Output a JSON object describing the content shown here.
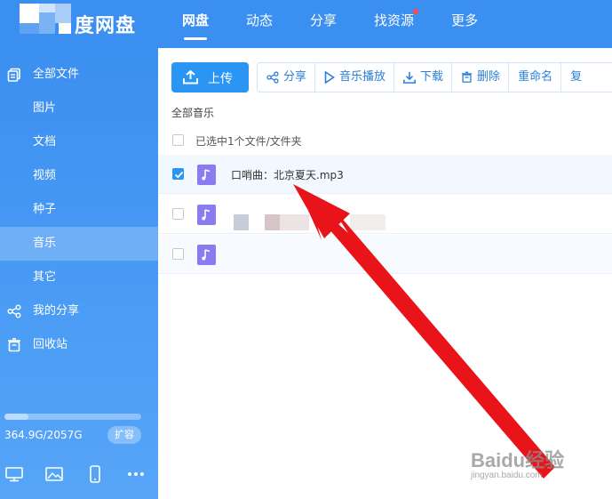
{
  "app": {
    "logo_text": "度网盘",
    "nav": [
      {
        "label": "网盘",
        "active": true
      },
      {
        "label": "动态",
        "active": false
      },
      {
        "label": "分享",
        "active": false
      },
      {
        "label": "找资源",
        "active": false,
        "badge": true
      },
      {
        "label": "更多",
        "active": false
      }
    ]
  },
  "sidebar": {
    "items": [
      {
        "label": "全部文件",
        "icon": "files-icon"
      },
      {
        "label": "图片"
      },
      {
        "label": "文档"
      },
      {
        "label": "视频"
      },
      {
        "label": "种子"
      },
      {
        "label": "音乐",
        "active": true
      },
      {
        "label": "其它"
      },
      {
        "label": "我的分享",
        "icon": "share-icon"
      },
      {
        "label": "回收站",
        "icon": "trash-icon"
      }
    ],
    "storage": {
      "text": "364.9G/2057G",
      "used_fraction": 0.177,
      "expand_label": "扩容"
    },
    "bottom_icons": [
      "desktop-icon",
      "image-icon",
      "phone-icon",
      "more-icon"
    ]
  },
  "toolbar": {
    "upload_label": "上传",
    "share_label": "分享",
    "play_label": "音乐播放",
    "download_label": "下载",
    "delete_label": "删除",
    "rename_label": "重命名",
    "copy_label": "复"
  },
  "main": {
    "breadcrumb": "全部音乐",
    "selection_text": "已选中1个文件/文件夹",
    "files": [
      {
        "name": "口哨曲：北京夏天.mp3",
        "checked": true
      },
      {
        "name": "",
        "checked": false
      },
      {
        "name": "",
        "checked": false
      }
    ]
  },
  "watermark": {
    "main": "Baidu经验",
    "sub": "jingyan.baidu.com"
  },
  "colors": {
    "brand": "#3b8ff0",
    "accent": "#2a95f2",
    "annotation": "#e8141a"
  }
}
